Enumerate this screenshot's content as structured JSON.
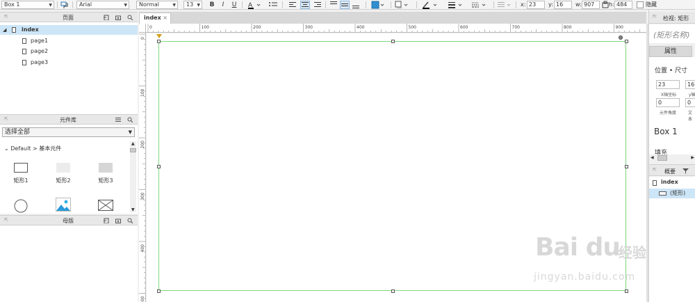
{
  "toolbar": {
    "element_name": "Box 1",
    "font_family": "Arial",
    "font_style": "Normal",
    "font_size": "13",
    "bold": "B",
    "italic": "I",
    "underline": "U",
    "x_label": "x:",
    "x_value": "23",
    "y_label": "y:",
    "y_value": "16",
    "w_label": "w:",
    "w_value": "907",
    "h_label": "h:",
    "h_value": "484",
    "hide_label": "隐藏",
    "fill_color": "#2d8fd0"
  },
  "pages_panel": {
    "title": "页面",
    "items": [
      {
        "label": "index"
      },
      {
        "label": "page1"
      },
      {
        "label": "page2"
      },
      {
        "label": "page3"
      }
    ]
  },
  "library_panel": {
    "title": "元件库",
    "select_value": "选择全部",
    "group_label": "Default > 基本元件",
    "items": [
      {
        "label": "矩形1"
      },
      {
        "label": "矩形2"
      },
      {
        "label": "矩形3"
      }
    ]
  },
  "masters_panel": {
    "title": "母版"
  },
  "canvas": {
    "tab_label": "index",
    "tab_close": "×",
    "ruler_top": [
      "0",
      "100",
      "200",
      "300",
      "400",
      "500",
      "600",
      "700",
      "800",
      "900"
    ],
    "ruler_left": [
      "0",
      "100",
      "200",
      "300",
      "400",
      "500"
    ]
  },
  "inspector": {
    "title": "检视: 矩形",
    "shape_name_placeholder": "(矩形名称)",
    "tab_properties": "属性",
    "section_position_size": "位置 • 尺寸",
    "x_value": "23",
    "y_value": "16",
    "x_caption": "X轴坐标",
    "y_caption": "y轴",
    "rotation_value": "0",
    "text_rotation_value": "0",
    "rotation_caption": "元件角度",
    "text_caption": "文本",
    "element_label": "Box 1",
    "fill_label": "填充"
  },
  "outline_panel": {
    "title": "概要",
    "root": "index",
    "child": "(矩形)"
  },
  "watermark": {
    "brand": "Bai du",
    "cn": "经验",
    "url": "jingyan.baidu.com"
  }
}
